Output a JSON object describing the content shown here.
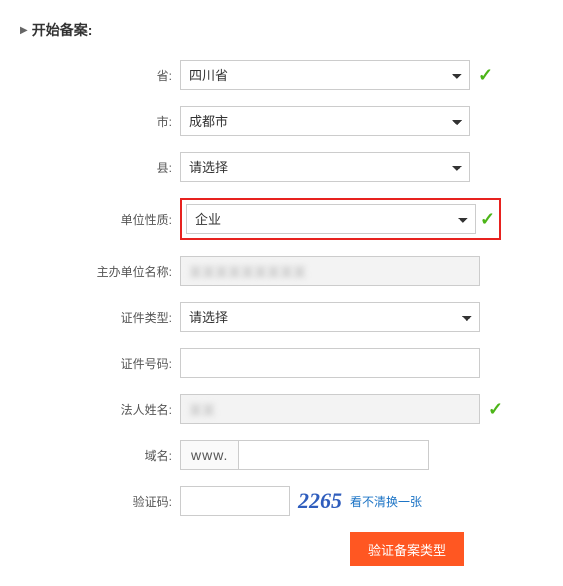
{
  "header": {
    "title": "开始备案:"
  },
  "fields": {
    "province": {
      "label": "省:",
      "value": "四川省"
    },
    "city": {
      "label": "市:",
      "value": "成都市"
    },
    "county": {
      "label": "县:",
      "value": "请选择"
    },
    "org_type": {
      "label": "单位性质:",
      "value": "企业"
    },
    "sponsor_name": {
      "label": "主办单位名称:",
      "value": ""
    },
    "cert_type": {
      "label": "证件类型:",
      "value": "请选择"
    },
    "cert_number": {
      "label": "证件号码:",
      "value": ""
    },
    "legal_name": {
      "label": "法人姓名:",
      "value": ""
    },
    "domain": {
      "label": "域名:",
      "prefix": "www.",
      "value": ""
    },
    "captcha": {
      "label": "验证码:",
      "value": "",
      "image_text": "2265",
      "refresh_text": "看不清换一张"
    }
  },
  "submit_label": "验证备案类型"
}
